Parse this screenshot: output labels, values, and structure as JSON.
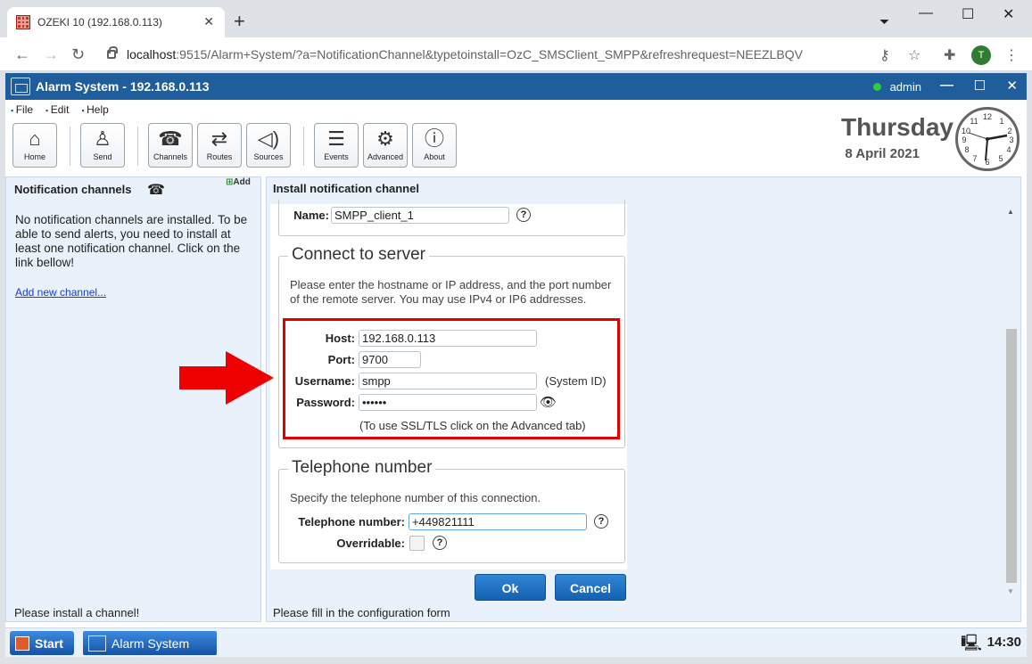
{
  "browser": {
    "tab_title": "OZEKI 10 (192.168.0.113)",
    "url_host": "localhost",
    "url_rest": ":9515/Alarm+System/?a=NotificationChannel&typetoinstall=OzC_SMSClient_SMPP&refreshrequest=NEEZLBQV",
    "avatar_letter": "T"
  },
  "app": {
    "title": "Alarm System - 192.168.0.113",
    "user": "admin"
  },
  "menu": [
    "File",
    "Edit",
    "Help"
  ],
  "toolbar": {
    "home": "Home",
    "send": "Send",
    "channels": "Channels",
    "routes": "Routes",
    "sources": "Sources",
    "events": "Events",
    "advanced": "Advanced",
    "about": "About"
  },
  "datetime": {
    "day": "Thursday",
    "date": "8 April 2021"
  },
  "left": {
    "title": "Notification channels",
    "add": "Add",
    "message": "No notification channels are installed. To be able to send alerts, you need to install at least one notification channel. Click on the link bellow!",
    "link": "Add new channel...",
    "status": "Please install a channel!"
  },
  "main": {
    "title": "Install notification channel",
    "name_label": "Name:",
    "name_value": "SMPP_client_1",
    "connect": {
      "legend": "Connect to server",
      "description": "Please enter the hostname or IP address, and the port number of the remote server. You may use IPv4 or IP6 addresses.",
      "host_label": "Host:",
      "host_value": "192.168.0.113",
      "port_label": "Port:",
      "port_value": "9700",
      "username_label": "Username:",
      "username_value": "smpp",
      "username_note": "(System ID)",
      "password_label": "Password:",
      "password_value": "••••••",
      "ssl_note": "(To use SSL/TLS click on the Advanced tab)"
    },
    "telephone": {
      "legend": "Telephone number",
      "description": "Specify the telephone number of this connection.",
      "number_label": "Telephone number:",
      "number_value": "+449821111",
      "overridable_label": "Overridable:"
    },
    "ok": "Ok",
    "cancel": "Cancel",
    "status": "Please fill in the configuration form"
  },
  "taskbar": {
    "start": "Start",
    "item": "Alarm System",
    "time": "14:30"
  },
  "colors": {
    "title_bar": "#1f5d9b",
    "button": "#1461b1",
    "highlight": "#e00000"
  }
}
